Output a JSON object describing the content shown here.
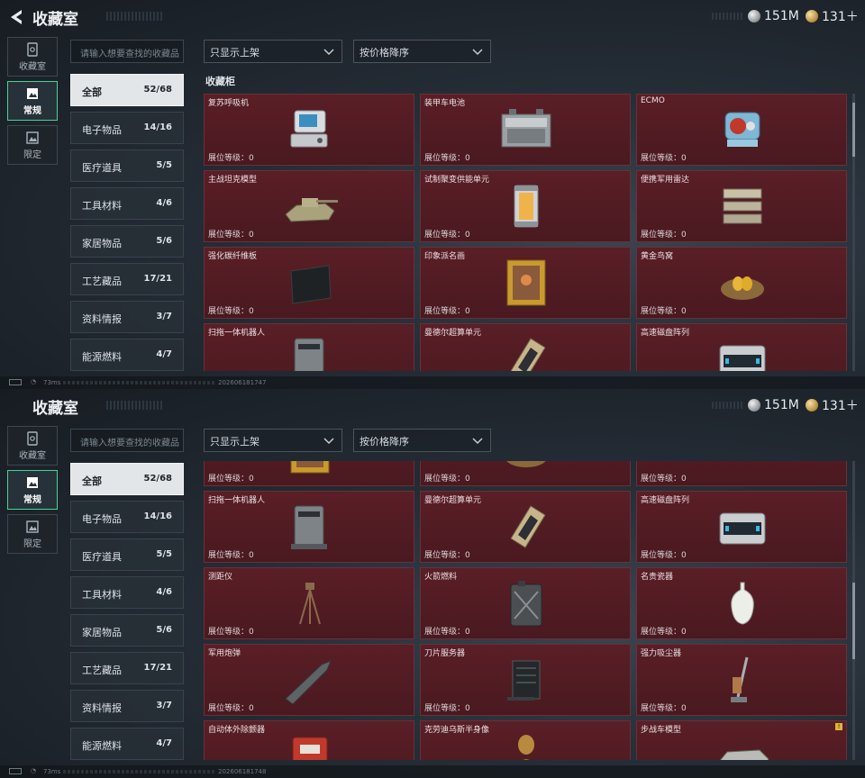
{
  "header": {
    "title": "收藏室",
    "currency_silver": "151M",
    "currency_gold": "131＋"
  },
  "left_nav": [
    {
      "label": "收藏室",
      "icon": "vault-icon",
      "active": false
    },
    {
      "label": "常规",
      "icon": "picture-icon",
      "active": true
    },
    {
      "label": "限定",
      "icon": "photo-icon",
      "active": false
    }
  ],
  "search": {
    "placeholder": "请输入想要查找的收藏品"
  },
  "filters": {
    "display": "只显示上架",
    "sort": "按价格降序"
  },
  "categories": [
    {
      "label": "全部",
      "count": "52/68",
      "active": true
    },
    {
      "label": "电子物品",
      "count": "14/16"
    },
    {
      "label": "医疗道具",
      "count": "5/5"
    },
    {
      "label": "工具材料",
      "count": "4/6"
    },
    {
      "label": "家居物品",
      "count": "5/6"
    },
    {
      "label": "工艺藏品",
      "count": "17/21"
    },
    {
      "label": "资料情报",
      "count": "3/7"
    },
    {
      "label": "能源燃料",
      "count": "4/7"
    }
  ],
  "section_title": "收藏柜",
  "level_label": "展位等级：0",
  "items_top": [
    {
      "name": "复苏呼吸机",
      "icon": "ventilator-icon"
    },
    {
      "name": "装甲车电池",
      "icon": "battery-icon"
    },
    {
      "name": "ECMO",
      "icon": "ecmo-icon"
    },
    {
      "name": "主战坦克模型",
      "icon": "tank-model-icon"
    },
    {
      "name": "试制聚变供能单元",
      "icon": "fusion-cell-icon"
    },
    {
      "name": "便携军用雷达",
      "icon": "radar-icon"
    },
    {
      "name": "强化碳纤维板",
      "icon": "carbon-plate-icon"
    },
    {
      "name": "印象派名画",
      "icon": "painting-icon"
    },
    {
      "name": "黄金鸟窝",
      "icon": "golden-nest-icon"
    },
    {
      "name": "扫拖一体机器人",
      "icon": "robot-vacuum-icon"
    },
    {
      "name": "曼德尔超算单元",
      "icon": "supercomputer-icon"
    },
    {
      "name": "高速磁盘阵列",
      "icon": "disk-array-icon"
    }
  ],
  "items_bottom": [
    {
      "name": "",
      "icon": "painting-icon"
    },
    {
      "name": "",
      "icon": "golden-nest-icon"
    },
    {
      "name": "",
      "icon": ""
    },
    {
      "name": "扫拖一体机器人",
      "icon": "robot-vacuum-icon"
    },
    {
      "name": "曼德尔超算单元",
      "icon": "supercomputer-icon"
    },
    {
      "name": "高速磁盘阵列",
      "icon": "disk-array-icon"
    },
    {
      "name": "测距仪",
      "icon": "rangefinder-icon"
    },
    {
      "name": "火箭燃料",
      "icon": "fuel-can-icon"
    },
    {
      "name": "名贵瓷器",
      "icon": "porcelain-vase-icon"
    },
    {
      "name": "军用炮弹",
      "icon": "artillery-shell-icon"
    },
    {
      "name": "刀片服务器",
      "icon": "blade-server-icon"
    },
    {
      "name": "强力吸尘器",
      "icon": "vacuum-cleaner-icon"
    },
    {
      "name": "自动体外除颤器",
      "icon": "defibrillator-icon"
    },
    {
      "name": "克劳迪乌斯半身像",
      "icon": "bust-icon"
    },
    {
      "name": "步战车模型",
      "icon": "ifv-model-icon",
      "badge": "!"
    }
  ],
  "status": {
    "ping": "73ms",
    "timestamp_top": "202606181747",
    "timestamp_bottom": "202606181748"
  },
  "colors": {
    "card_bg": "#4f1b22",
    "accent_green": "#49d39a",
    "gold": "#e1b437"
  }
}
